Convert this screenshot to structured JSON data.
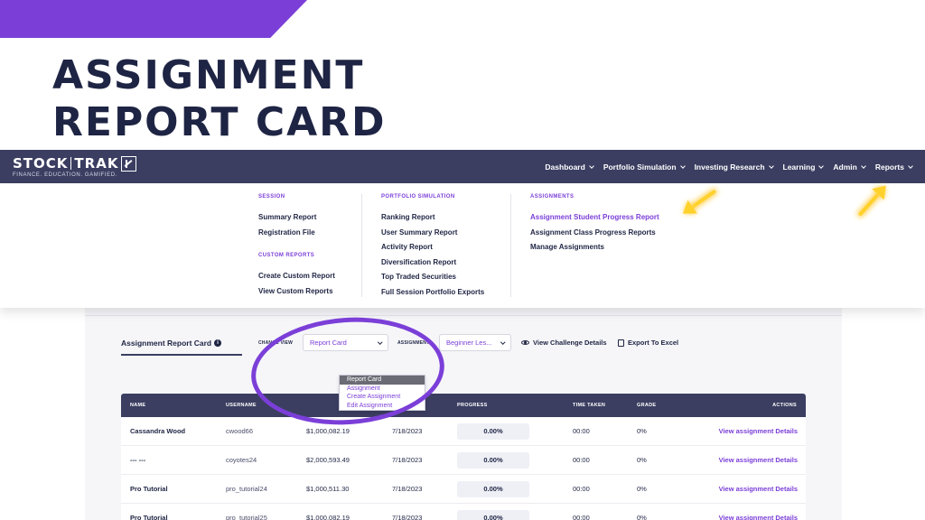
{
  "colors": {
    "accent": "#7b3fd8",
    "navy": "#1e2443",
    "navbar": "#3b3e61",
    "highlight_arrow": "#ffd12b"
  },
  "headline": {
    "line1": "ASSIGNMENT",
    "line2": "REPORT CARD"
  },
  "logo": {
    "left": "STOCK",
    "right": "TRAK",
    "tagline": "FINANCE. EDUCATION. GAMIFIED."
  },
  "nav": {
    "items": [
      {
        "label": "Dashboard"
      },
      {
        "label": "Portfolio Simulation"
      },
      {
        "label": "Investing Research"
      },
      {
        "label": "Learning"
      },
      {
        "label": "Admin"
      },
      {
        "label": "Reports"
      }
    ]
  },
  "mega_menu": {
    "session": {
      "heading": "SESSION",
      "items": [
        "Summary Report",
        "Registration File"
      ]
    },
    "custom_reports": {
      "heading": "CUSTOM REPORTS",
      "items": [
        "Create Custom Report",
        "View Custom Reports"
      ]
    },
    "portfolio_simulation": {
      "heading": "PORTFOLIO SIMULATION",
      "items": [
        "Ranking Report",
        "User Summary Report",
        "Activity Report",
        "Diversification Report",
        "Top Traded Securities",
        "Full Session Portfolio Exports"
      ]
    },
    "assignments": {
      "heading": "ASSIGNMENTS",
      "items": [
        "Assignment Student Progress Report",
        "Assignment Class Progress Reports",
        "Manage Assignments"
      ]
    }
  },
  "page": {
    "tab_title": "Assignment Report Card",
    "info_icon": "i",
    "change_view_label": "CHANGE VIEW",
    "change_view_value": "Report Card",
    "change_view_options": [
      "Report Card",
      "Assignment",
      "Create Assignment",
      "Edit Assignment"
    ],
    "assignment_label": "ASSIGNMENT",
    "assignment_value": "Beginner Les...",
    "view_challenge": "View Challenge Details",
    "export": "Export To Excel"
  },
  "table": {
    "headers": {
      "name": "NAME",
      "username": "USERNAME",
      "last_login": "LAST LOGIN",
      "progress": "PROGRESS",
      "time_taken": "TIME TAKEN",
      "grade": "GRADE",
      "actions": "ACTIONS"
    },
    "rows": [
      {
        "name": "Cassandra Wood",
        "username": "cwood66",
        "value": "$1,000,082.19",
        "last_login": "7/18/2023",
        "progress": "0.00%",
        "time_taken": "00:00",
        "grade": "0%",
        "action": "View assignment Details"
      },
      {
        "name": "--- ---",
        "username": "coyotes24",
        "value": "$2,000,593.49",
        "last_login": "7/18/2023",
        "progress": "0.00%",
        "time_taken": "00:00",
        "grade": "0%",
        "action": "View assignment Details"
      },
      {
        "name": "Pro Tutorial",
        "username": "pro_tutorial24",
        "value": "$1,000,511.30",
        "last_login": "7/18/2023",
        "progress": "0.00%",
        "time_taken": "00:00",
        "grade": "0%",
        "action": "View assignment Details"
      },
      {
        "name": "Pro Tutorial",
        "username": "pro_tutorial25",
        "value": "$1,000,082.19",
        "last_login": "7/18/2023",
        "progress": "0.00%",
        "time_taken": "00:00",
        "grade": "0%",
        "action": "View assignment Details"
      }
    ]
  }
}
